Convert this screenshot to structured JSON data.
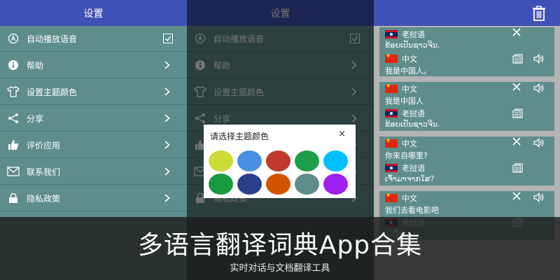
{
  "settings_panel": {
    "title": "设置",
    "items": [
      {
        "label": "自动播放语音",
        "icon": "autoplay-icon",
        "action": "checkbox"
      },
      {
        "label": "帮助",
        "icon": "info-icon",
        "action": "chevron"
      },
      {
        "label": "设置主题颜色",
        "icon": "shirt-icon",
        "action": "chevron"
      },
      {
        "label": "分享",
        "icon": "share-icon",
        "action": "chevron"
      },
      {
        "label": "评价应用",
        "icon": "thumbs-up-icon",
        "action": "chevron"
      },
      {
        "label": "联系我们",
        "icon": "mail-icon",
        "action": "chevron"
      },
      {
        "label": "隐私政策",
        "icon": "lock-icon",
        "action": "chevron"
      }
    ]
  },
  "theme_dialog": {
    "title": "请选择主题颜色",
    "close_label": "×",
    "colors": [
      "#cddc39",
      "#4a90e2",
      "#c0392b",
      "#1e9e4a",
      "#00bfff",
      "#169b3c",
      "#2c3e8c",
      "#d35400",
      "#5e8d8b",
      "#a020f0"
    ]
  },
  "history_panel": {
    "cards": [
      {
        "lines": [
          {
            "kind": "lang",
            "flag": "la",
            "label": "老挝语"
          },
          {
            "kind": "text",
            "label": "ຂ້ອຍເປັນຊາວຈີນ."
          },
          {
            "kind": "lang",
            "flag": "cn",
            "label": "中文"
          },
          {
            "kind": "text",
            "label": "我是中国人。"
          }
        ]
      },
      {
        "lines": [
          {
            "kind": "lang",
            "flag": "cn",
            "label": "中文"
          },
          {
            "kind": "text",
            "label": "我是中国人"
          },
          {
            "kind": "lang",
            "flag": "la",
            "label": "老挝语"
          },
          {
            "kind": "text",
            "label": "ຂ້ອຍເປັນຊາວຈີນ."
          }
        ]
      },
      {
        "lines": [
          {
            "kind": "lang",
            "flag": "cn",
            "label": "中文"
          },
          {
            "kind": "text",
            "label": "你来自哪里?"
          },
          {
            "kind": "lang",
            "flag": "la",
            "label": "老挝语"
          },
          {
            "kind": "text",
            "label": "ເຈົ້າມາຈາກໃສ?"
          }
        ]
      },
      {
        "lines": [
          {
            "kind": "lang",
            "flag": "cn",
            "label": "中文"
          },
          {
            "kind": "text",
            "label": "我们去看电影吧"
          },
          {
            "kind": "lang",
            "flag": "la",
            "label": "老挝语"
          },
          {
            "kind": "text",
            "label": "...ເງົ້າ."
          }
        ]
      }
    ]
  },
  "banner": {
    "title": "多语言翻译词典App合集",
    "subtitle": "实时对话与文档翻译工具"
  }
}
